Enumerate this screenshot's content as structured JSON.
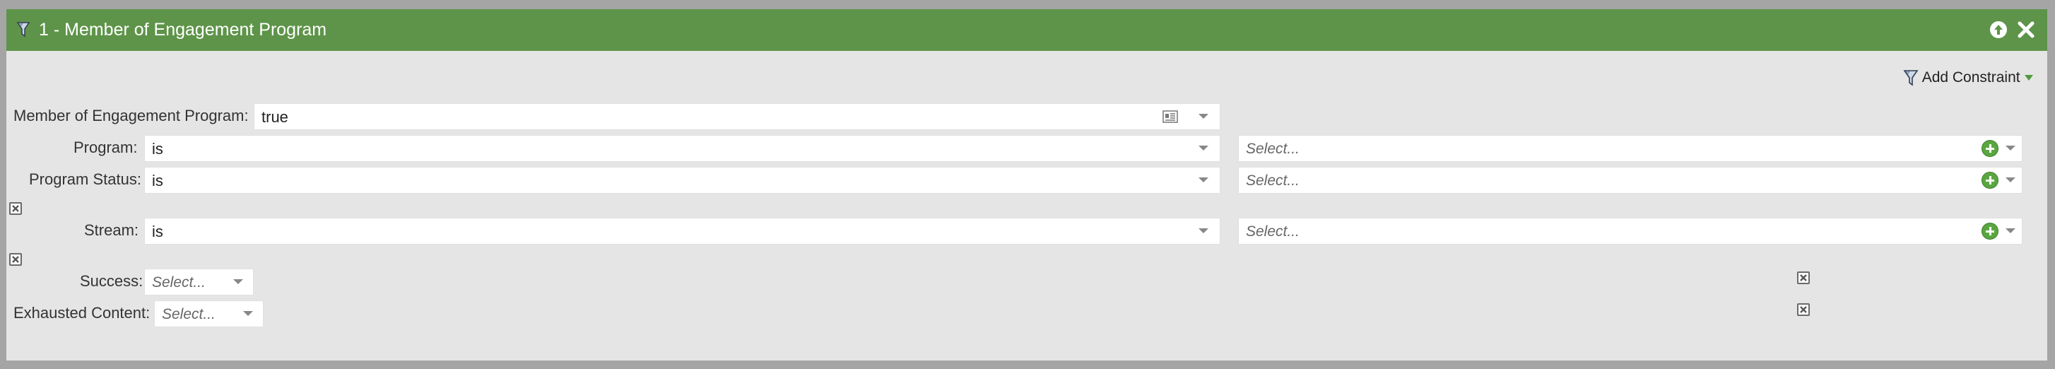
{
  "panel": {
    "title": "1 - Member of Engagement Program",
    "add_constraint_label": "Add Constraint"
  },
  "rows": {
    "member": {
      "label": "Member of Engagement Program:",
      "value": "true"
    },
    "program": {
      "label": "Program:",
      "operator": "is",
      "value_placeholder": "Select..."
    },
    "program_status": {
      "label": "Program Status:",
      "operator": "is",
      "value_placeholder": "Select..."
    },
    "stream": {
      "label": "Stream:",
      "operator": "is",
      "value_placeholder": "Select..."
    },
    "success": {
      "label": "Success:",
      "placeholder": "Select..."
    },
    "exhausted": {
      "label": "Exhausted Content:",
      "placeholder": "Select..."
    }
  },
  "colors": {
    "header_bg": "#5e9449",
    "panel_bg": "#e5e5e5",
    "add_icon": "#5aa641"
  },
  "icons": [
    "filter-funnel-icon",
    "collapse-up-icon",
    "close-icon",
    "caret-down-icon",
    "list-detail-icon",
    "add-circle-icon",
    "remove-x-icon"
  ]
}
